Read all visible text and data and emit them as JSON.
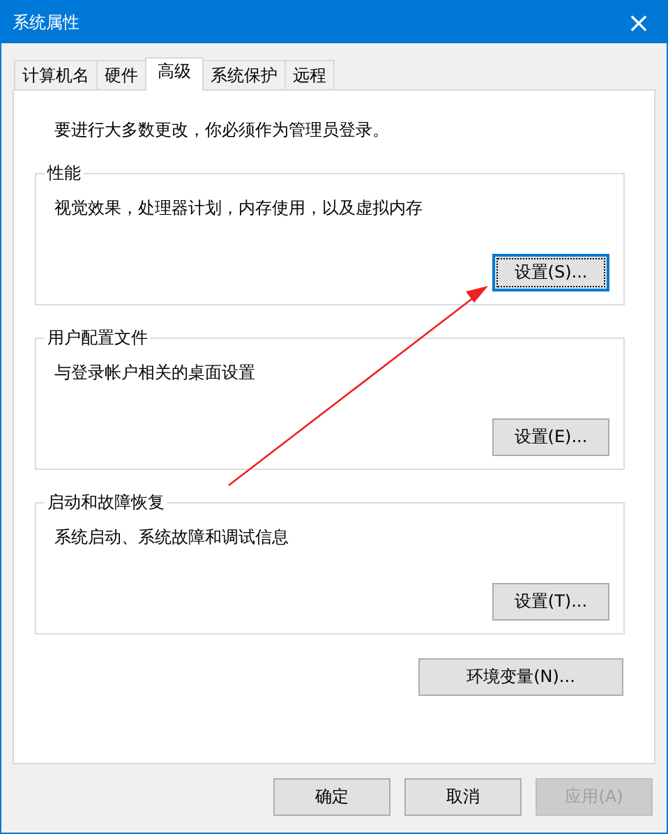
{
  "window": {
    "title": "系统属性",
    "close": "×"
  },
  "tabs": [
    {
      "label": "计算机名",
      "selected": false
    },
    {
      "label": "硬件",
      "selected": false
    },
    {
      "label": "高级",
      "selected": true
    },
    {
      "label": "系统保护",
      "selected": false
    },
    {
      "label": "远程",
      "selected": false
    }
  ],
  "notice": "要进行大多数更改，你必须作为管理员登录。",
  "groups": [
    {
      "title": "性能",
      "description": "视觉效果，处理器计划，内存使用，以及虚拟内存",
      "button": {
        "label": "设置(S)...",
        "focused": true
      }
    },
    {
      "title": "用户配置文件",
      "description": "与登录帐户相关的桌面设置",
      "button": {
        "label": "设置(E)...",
        "focused": false
      }
    },
    {
      "title": "启动和故障恢复",
      "description": "系统启动、系统故障和调试信息",
      "button": {
        "label": "设置(T)...",
        "focused": false
      }
    }
  ],
  "environment_button": "环境变量(N)...",
  "footer_buttons": [
    {
      "label": "确定",
      "disabled": false
    },
    {
      "label": "取消",
      "disabled": false
    },
    {
      "label": "应用(A)",
      "disabled": true
    }
  ],
  "annotations": [
    {
      "kind": "arrow"
    }
  ]
}
